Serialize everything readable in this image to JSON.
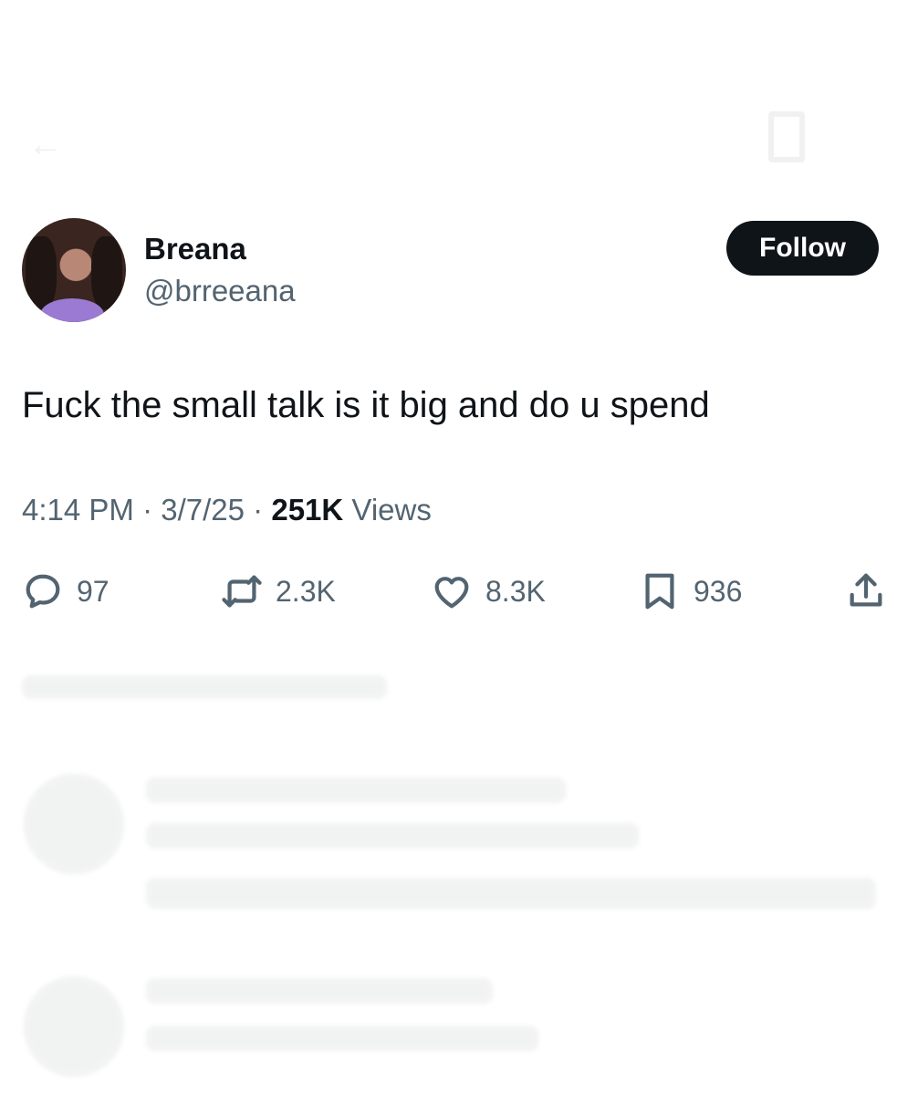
{
  "tweet": {
    "author": {
      "display_name": "Breana",
      "handle": "@brreeana",
      "follow_label": "Follow"
    },
    "text": "Fuck the small talk is it big and do u spend",
    "meta": {
      "time": "4:14 PM",
      "date": "3/7/25",
      "views_count": "251K",
      "views_label": "Views",
      "separator": "·"
    },
    "actions": {
      "replies": "97",
      "reposts": "2.3K",
      "likes": "8.3K",
      "bookmarks": "936"
    }
  },
  "icons": [
    "reply-icon",
    "repost-icon",
    "like-icon",
    "bookmark-icon",
    "share-icon",
    "back-arrow-icon"
  ],
  "colors": {
    "text_primary": "#0f1419",
    "text_secondary": "#536471",
    "follow_button_bg": "#0f1419",
    "background": "#ffffff"
  }
}
